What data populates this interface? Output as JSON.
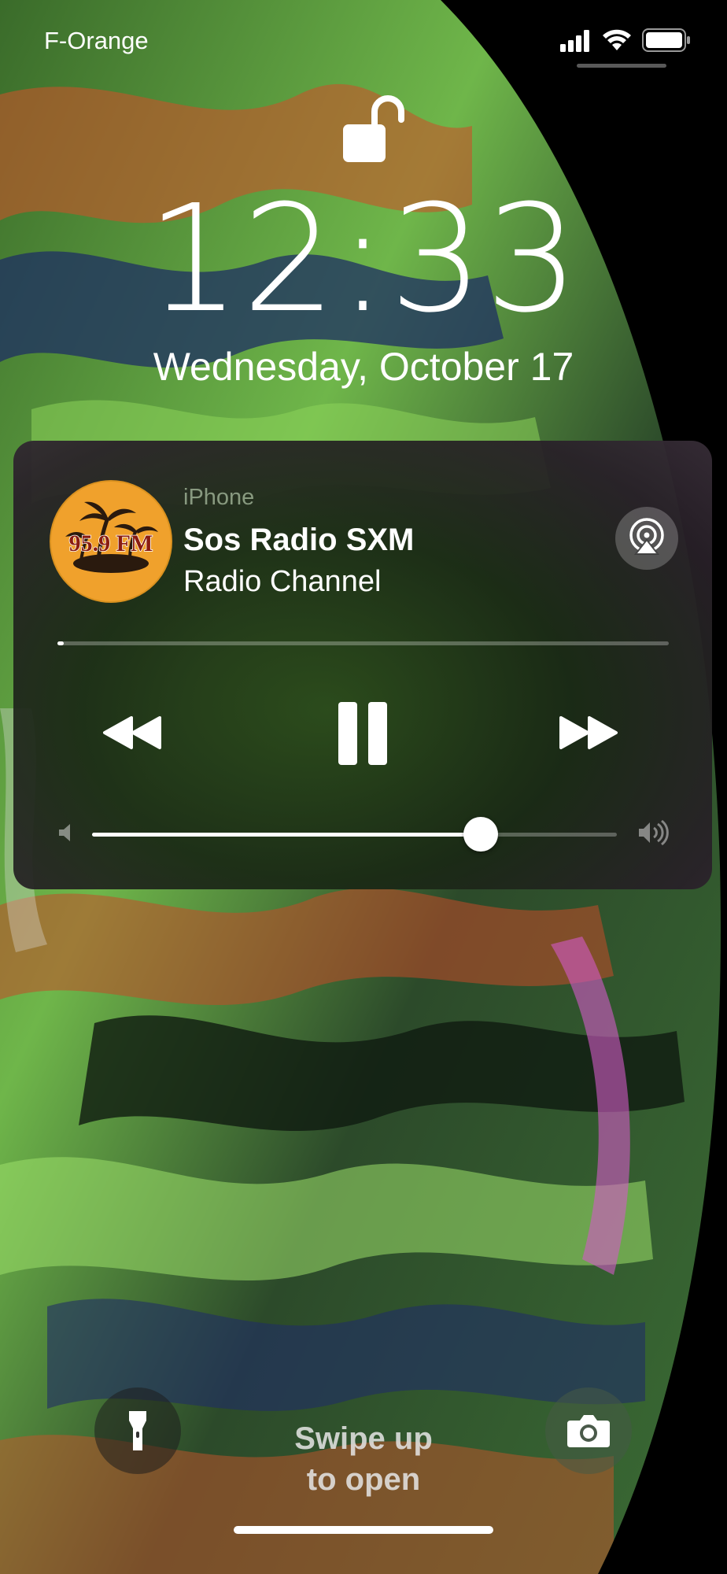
{
  "status_bar": {
    "carrier": "F-Orange",
    "battery_icon": "battery-icon",
    "wifi_icon": "wifi-icon",
    "signal_icon": "signal-icon"
  },
  "lock": {
    "icon": "unlocked-padlock-icon",
    "time": "12:33",
    "date": "Wednesday, October 17"
  },
  "now_playing": {
    "source": "iPhone",
    "artwork_label": "95.9 FM",
    "title": "Sos Radio SXM",
    "subtitle": "Radio Channel",
    "progress": 0.005,
    "volume": 0.74,
    "controls": {
      "rewind_icon": "rewind-icon",
      "pause_icon": "pause-icon",
      "forward_icon": "fast-forward-icon",
      "airplay_icon": "airplay-audio-icon"
    }
  },
  "bottom": {
    "flashlight_icon": "flashlight-icon",
    "camera_icon": "camera-icon",
    "swipe_line1": "Swipe up",
    "swipe_line2": "to open"
  },
  "colors": {
    "card_bg": "#1f2e1a",
    "art_orange": "#f0a12c",
    "art_text": "#8a1c10"
  }
}
